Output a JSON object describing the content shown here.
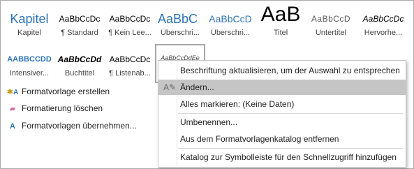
{
  "styles_row1": [
    {
      "preview": "Kapitel",
      "name": "Kapitel"
    },
    {
      "preview": "AaBbCcDc",
      "name": "¶ Standard"
    },
    {
      "preview": "AaBbCcDc",
      "name": "¶ Kein Lee..."
    },
    {
      "preview": "AaBbC",
      "name": "Überschri..."
    },
    {
      "preview": "AaBbCcD",
      "name": "Überschri..."
    },
    {
      "preview": "AaB",
      "name": "Titel"
    },
    {
      "preview": "AaBbCcD",
      "name": "Untertitel"
    },
    {
      "preview": "AaBbCcDc",
      "name": "Hervorhe..."
    }
  ],
  "styles_row2": [
    {
      "preview": "AABBCCDD",
      "name": "Intensiver..."
    },
    {
      "preview": "AaBbCcDd",
      "name": "Buchtitel"
    },
    {
      "preview": "AaBbCcDc",
      "name": "¶ Listenab..."
    },
    {
      "preview": "AaBbCcDdEe",
      "name": ""
    }
  ],
  "commands": [
    {
      "label": "Formatvorlage erstellen",
      "icon": "create-style-icon"
    },
    {
      "label": "Formatierung löschen",
      "icon": "clear-formatting-icon"
    },
    {
      "label": "Formatvorlagen übernehmen...",
      "icon": "apply-styles-icon"
    }
  ],
  "context_menu": {
    "items": [
      "Beschriftung aktualisieren, um der Auswahl zu entsprechen",
      "Ändern...",
      "Alles markieren: (Keine Daten)",
      "Umbenennen...",
      "Aus dem Formatvorlagenkatalog entfernen",
      "Katalog zur Symbolleiste für den Schnellzugriff hinzufügen"
    ],
    "highlighted_index": 1
  },
  "colors": {
    "heading_blue": "#2e74b5",
    "highlight": "#c5c5c5",
    "border": "#ababab"
  }
}
